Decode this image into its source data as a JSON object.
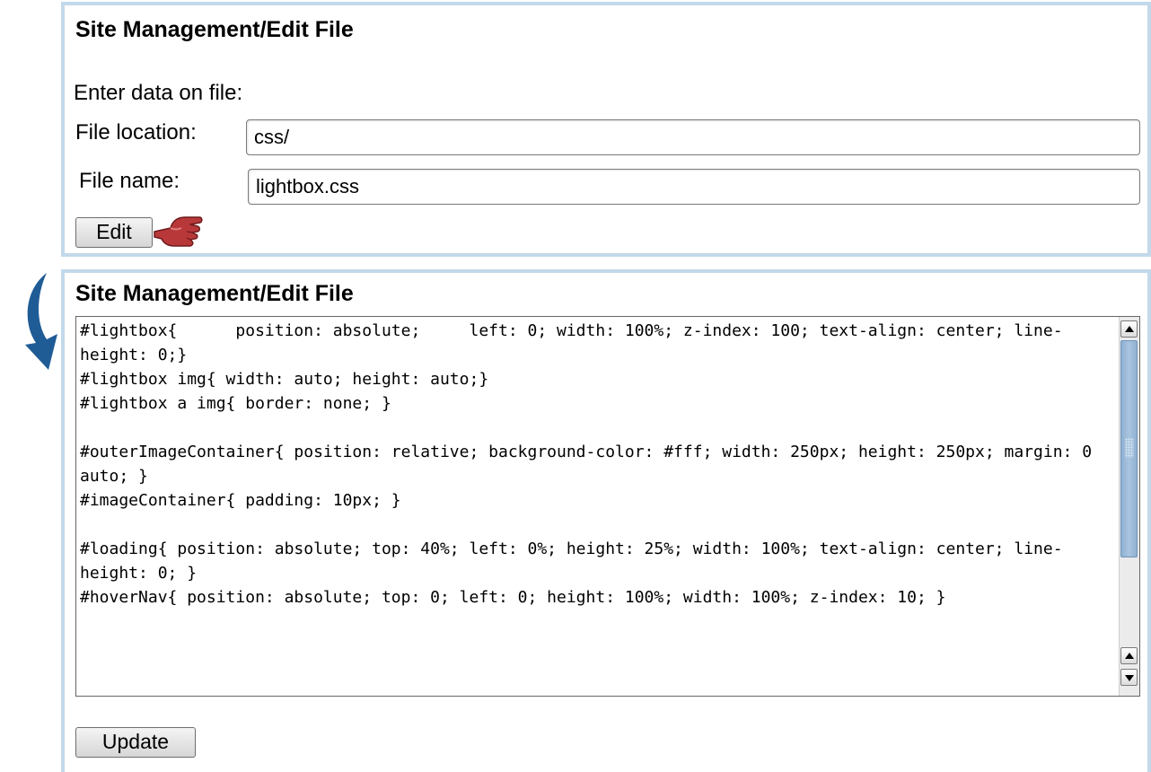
{
  "form": {
    "title": "Site Management/Edit File",
    "intro": "Enter data on file:",
    "location_label": "File location:",
    "location_value": "css/",
    "name_label": "File name:",
    "name_value": "lightbox.css",
    "edit_label": "Edit"
  },
  "editor": {
    "title": "Site Management/Edit File",
    "content": "#lightbox{      position: absolute;     left: 0; width: 100%; z-index: 100; text-align: center; line-height: 0;}\n#lightbox img{ width: auto; height: auto;}\n#lightbox a img{ border: none; }\n\n#outerImageContainer{ position: relative; background-color: #fff; width: 250px; height: 250px; margin: 0 auto; }\n#imageContainer{ padding: 10px; }\n\n#loading{ position: absolute; top: 40%; left: 0%; height: 25%; width: 100%; text-align: center; line-height: 0; }\n#hoverNav{ position: absolute; top: 0; left: 0; height: 100%; width: 100%; z-index: 10; }",
    "update_label": "Update"
  },
  "icons": {
    "pointer": "hand-pointer-icon",
    "arrow": "curved-arrow-icon"
  },
  "colors": {
    "panel_border": "#c3d9ea",
    "arrow": "#1f5c96",
    "hand": "#b8383a",
    "scroll_thumb": "#a9c4df"
  }
}
